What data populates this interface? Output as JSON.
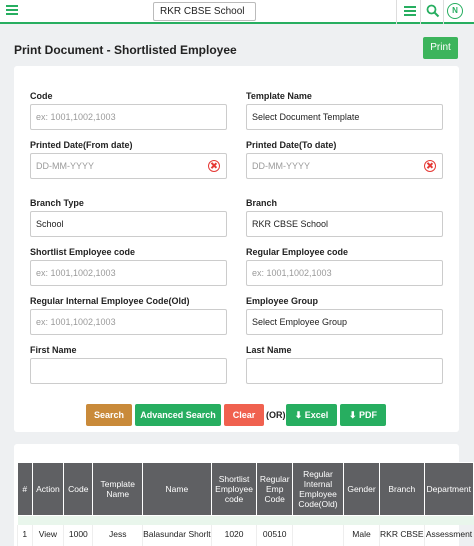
{
  "header": {
    "school": "RKR CBSE School",
    "avatar_initial": "N",
    "accent": "#27ae60"
  },
  "page": {
    "title": "Print Document - Shortlisted Employee",
    "print_label": "Print"
  },
  "form": {
    "code": {
      "label": "Code",
      "placeholder": "ex: 1001,1002,1003"
    },
    "template_name": {
      "label": "Template Name",
      "value": "Select Document Template"
    },
    "printed_from": {
      "label": "Printed Date(From date)",
      "placeholder": "DD-MM-YYYY"
    },
    "printed_to": {
      "label": "Printed Date(To date)",
      "placeholder": "DD-MM-YYYY"
    },
    "branch_type": {
      "label": "Branch Type",
      "value": "School"
    },
    "branch": {
      "label": "Branch",
      "value": "RKR CBSE School"
    },
    "shortlist_code": {
      "label": "Shortlist Employee code",
      "placeholder": "ex: 1001,1002,1003"
    },
    "regular_code": {
      "label": "Regular Employee code",
      "placeholder": "ex: 1001,1002,1003"
    },
    "regular_internal_code": {
      "label": "Regular Internal Employee Code(Old)",
      "placeholder": "ex: 1001,1002,1003"
    },
    "employee_group": {
      "label": "Employee Group",
      "value": "Select Employee Group"
    },
    "first_name": {
      "label": "First Name",
      "value": ""
    },
    "last_name": {
      "label": "Last Name",
      "value": ""
    }
  },
  "actions": {
    "search": "Search",
    "advanced_search": "Advanced Search",
    "clear": "Clear",
    "or": "(OR)",
    "excel": "Excel",
    "pdf": "PDF",
    "colors": {
      "search": "#c98a3a",
      "advanced": "#27ae60",
      "clear": "#f0614f",
      "export": "#27ae60"
    }
  },
  "table": {
    "headers": [
      "#",
      "Action",
      "Code",
      "Template Name",
      "Name",
      "Shortlist Employee code",
      "Regular Emp Code",
      "Regular Internal Employee Code(Old)",
      "Gender",
      "Branch",
      "Department"
    ],
    "rows": [
      [
        "1",
        "View",
        "1000",
        "Jess",
        "Balasundar Shorlt",
        "1020",
        "00510",
        "",
        "Male",
        "RKR CBSE",
        "Assessment"
      ]
    ]
  }
}
